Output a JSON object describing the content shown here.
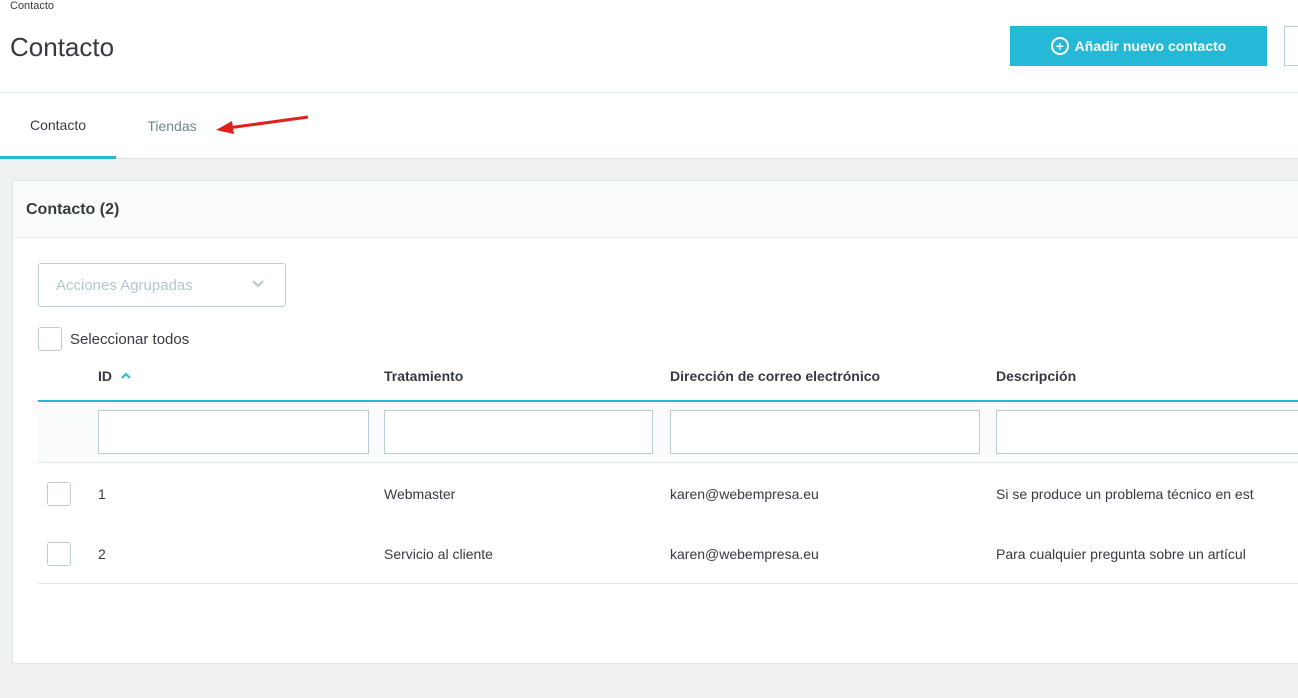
{
  "header": {
    "breadcrumb": "Contacto",
    "title": "Contacto",
    "add_button_label": "Añadir nuevo contacto"
  },
  "tabs": [
    {
      "label": "Contacto",
      "active": true
    },
    {
      "label": "Tiendas",
      "active": false
    }
  ],
  "panel": {
    "title": "Contacto (2)",
    "bulk_actions_label": "Acciones Agrupadas",
    "select_all_label": "Seleccionar todos"
  },
  "table": {
    "columns": [
      "ID",
      "Tratamiento",
      "Dirección de correo electrónico",
      "Descripción"
    ],
    "sorted_column": "ID",
    "sort_direction": "ascending",
    "rows": [
      {
        "id": "1",
        "name": "Webmaster",
        "email": "karen@webempresa.eu",
        "description": "Si se produce un problema técnico en est"
      },
      {
        "id": "2",
        "name": "Servicio al cliente",
        "email": "karen@webempresa.eu",
        "description": "Para cualquier pregunta sobre un artícul"
      }
    ]
  },
  "colors": {
    "accent": "#25b9d7",
    "annotation_arrow": "#e0201b"
  }
}
